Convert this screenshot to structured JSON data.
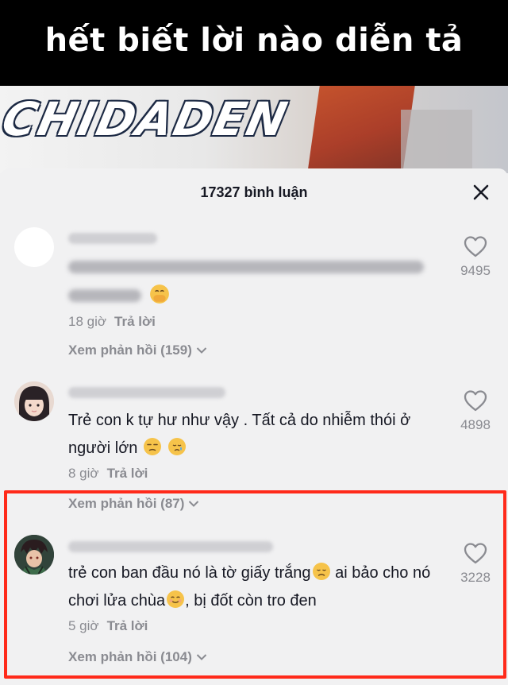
{
  "video": {
    "caption": "hết biết lời nào diễn tả",
    "watermark": "CHIDADEN"
  },
  "sheet": {
    "comment_count": "17327 bình luận",
    "close_icon": "close-icon"
  },
  "comments": [
    {
      "text_visible": "",
      "time": "18 giờ",
      "reply_label": "Trả lời",
      "view_replies": "Xem phản hồi (159)",
      "likes": "9495",
      "emoji": "hand-over-mouth-emoji"
    },
    {
      "text": "Trẻ con k tự hư như vậy . Tất cả do nhiễm thói ở người lớn",
      "emojis": [
        "unamused-emoji",
        "crying-emoji"
      ],
      "time": "8 giờ",
      "reply_label": "Trả lời",
      "view_replies": "Xem phản hồi (87)",
      "likes": "4898"
    },
    {
      "text_part1": "trẻ con ban đầu nó là tờ giấy trắng",
      "text_part2": " ai bảo cho nó chơi lửa chùa",
      "text_part3": ", bị đốt còn tro đen",
      "emojis": [
        "disappointed-emoji",
        "relieved-emoji"
      ],
      "time": "5 giờ",
      "reply_label": "Trả lời",
      "view_replies": "Xem phản hồi (104)",
      "likes": "3228",
      "highlight_color": "#ff2a1a"
    }
  ],
  "colors": {
    "sheet_bg": "#f1f1f2",
    "text": "#161823",
    "muted": "#8a8b91",
    "highlight": "#ff2a1a"
  }
}
